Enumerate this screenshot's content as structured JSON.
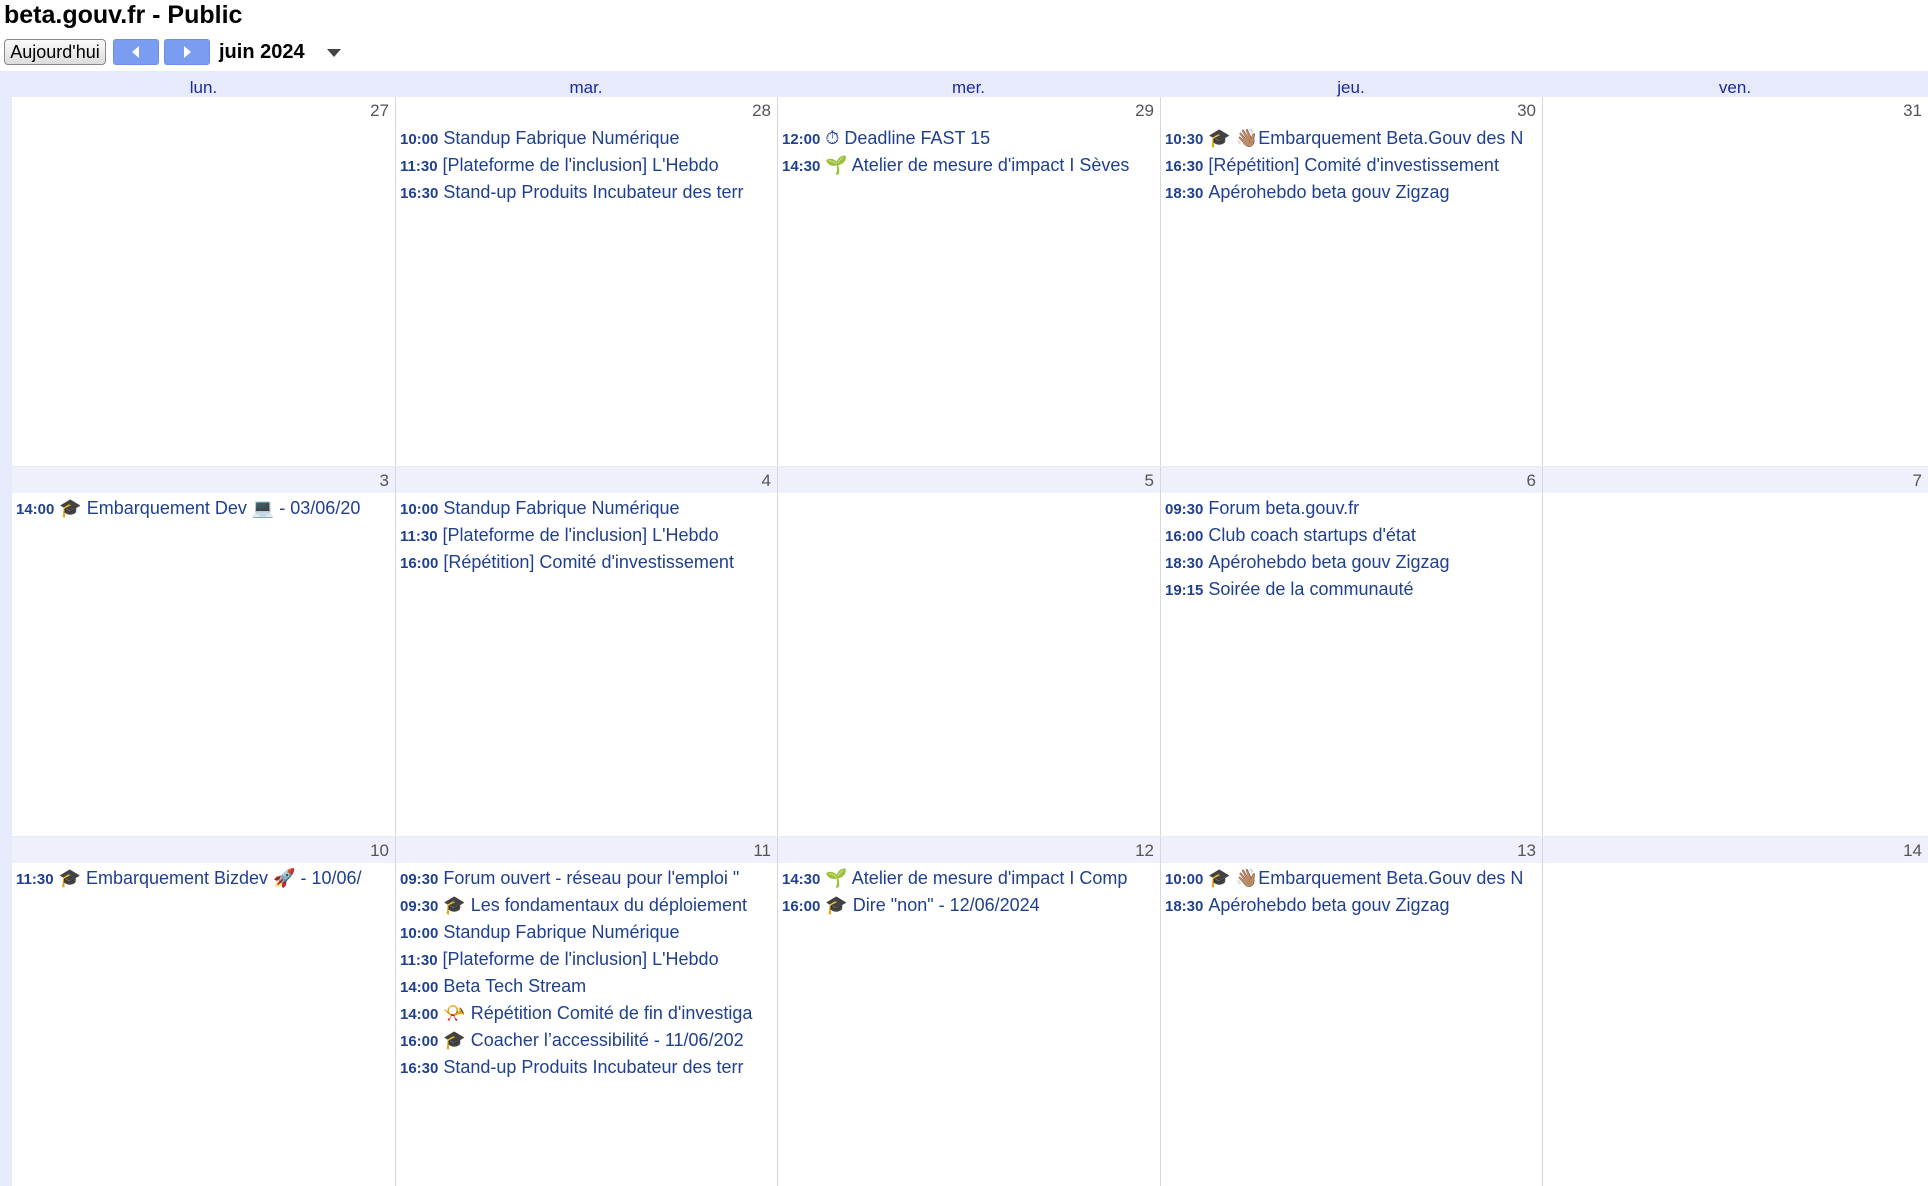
{
  "calendar_title": "beta.gouv.fr - Public",
  "toolbar": {
    "today_label": "Aujourd'hui",
    "month_label": "juin 2024",
    "prev_icon": "chevron-left-icon",
    "next_icon": "chevron-right-icon",
    "dropdown_icon": "caret-down-icon"
  },
  "colors": {
    "nav_button": "#7a9cf1",
    "header_bg": "#e7eafb",
    "event_text": "#1f3f8f",
    "day_header_text": "#1a2a9a"
  },
  "day_headers": [
    "lun.",
    "mar.",
    "mer.",
    "jeu.",
    "ven."
  ],
  "weeks": [
    {
      "days": [
        {
          "date": "27",
          "events": []
        },
        {
          "date": "28",
          "events": [
            {
              "time": "10:00",
              "title": "Standup Fabrique Numérique"
            },
            {
              "time": "11:30",
              "title": "[Plateforme de l'inclusion] L'Hebdo"
            },
            {
              "time": "16:30",
              "title": "Stand-up Produits Incubateur des terr"
            }
          ]
        },
        {
          "date": "29",
          "events": [
            {
              "time": "12:00",
              "title": "⏱ Deadline FAST 15"
            },
            {
              "time": "14:30",
              "title": "🌱 Atelier de mesure d'impact I Sèves"
            }
          ]
        },
        {
          "date": "30",
          "events": [
            {
              "time": "10:30",
              "title": "🎓 👋🏽Embarquement Beta.Gouv des N"
            },
            {
              "time": "16:30",
              "title": "[Répétition] Comité d'investissement"
            },
            {
              "time": "18:30",
              "title": "Apérohebdo beta gouv Zigzag"
            }
          ]
        },
        {
          "date": "31",
          "events": []
        }
      ]
    },
    {
      "days": [
        {
          "date": "3",
          "events": [
            {
              "time": "14:00",
              "title": "🎓 Embarquement Dev 💻 - 03/06/20"
            }
          ]
        },
        {
          "date": "4",
          "events": [
            {
              "time": "10:00",
              "title": "Standup Fabrique Numérique"
            },
            {
              "time": "11:30",
              "title": "[Plateforme de l'inclusion] L'Hebdo"
            },
            {
              "time": "16:00",
              "title": "[Répétition] Comité d'investissement"
            }
          ]
        },
        {
          "date": "5",
          "events": []
        },
        {
          "date": "6",
          "events": [
            {
              "time": "09:30",
              "title": "Forum beta.gouv.fr"
            },
            {
              "time": "16:00",
              "title": "Club coach startups d'état"
            },
            {
              "time": "18:30",
              "title": "Apérohebdo beta gouv Zigzag"
            },
            {
              "time": "19:15",
              "title": "Soirée de la communauté"
            }
          ]
        },
        {
          "date": "7",
          "events": []
        }
      ]
    },
    {
      "days": [
        {
          "date": "10",
          "events": [
            {
              "time": "11:30",
              "title": "🎓 Embarquement Bizdev 🚀 - 10/06/"
            }
          ]
        },
        {
          "date": "11",
          "events": [
            {
              "time": "09:30",
              "title": "Forum ouvert - réseau pour l'emploi \""
            },
            {
              "time": "09:30",
              "title": "🎓 Les fondamentaux du déploiement"
            },
            {
              "time": "10:00",
              "title": "Standup Fabrique Numérique"
            },
            {
              "time": "11:30",
              "title": "[Plateforme de l'inclusion] L'Hebdo"
            },
            {
              "time": "14:00",
              "title": "Beta Tech Stream"
            },
            {
              "time": "14:00",
              "title": "📯 Répétition Comité de fin d'investiga"
            },
            {
              "time": "16:00",
              "title": "🎓 Coacher l’accessibilité - 11/06/202"
            },
            {
              "time": "16:30",
              "title": "Stand-up Produits Incubateur des terr"
            }
          ]
        },
        {
          "date": "12",
          "events": [
            {
              "time": "14:30",
              "title": "🌱 Atelier de mesure d'impact I Comp"
            },
            {
              "time": "16:00",
              "title": "🎓 Dire \"non\" - 12/06/2024"
            }
          ]
        },
        {
          "date": "13",
          "events": [
            {
              "time": "10:00",
              "title": "🎓 👋🏽Embarquement Beta.Gouv des N"
            },
            {
              "time": "18:30",
              "title": "Apérohebdo beta gouv Zigzag"
            }
          ]
        },
        {
          "date": "14",
          "events": []
        }
      ]
    }
  ]
}
